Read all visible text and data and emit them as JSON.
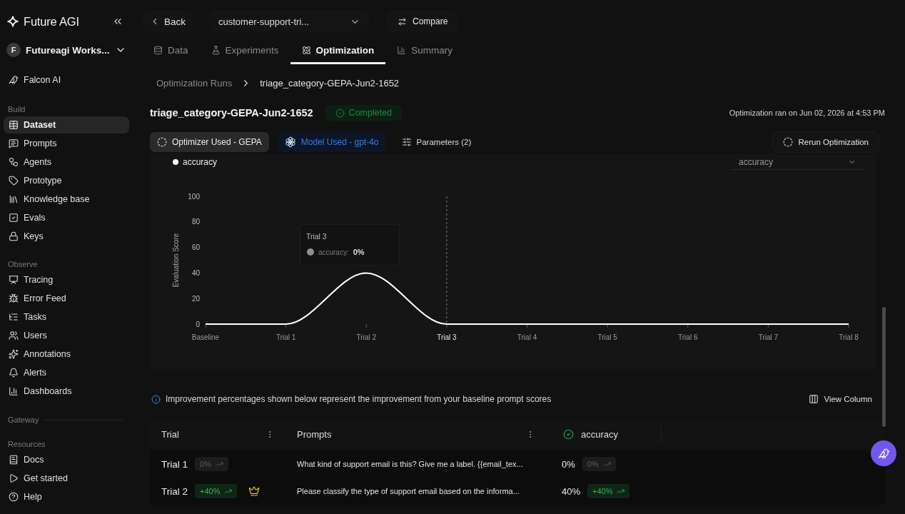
{
  "sidebar": {
    "brand": "Future AGI",
    "workspace": {
      "initial": "F",
      "name": "Futureagi Works..."
    },
    "pinned": [
      {
        "label": "Falcon AI",
        "selected": false
      }
    ],
    "sections": [
      {
        "title": "Build",
        "items": [
          {
            "label": "Dataset",
            "selected": true
          },
          {
            "label": "Prompts",
            "selected": false
          },
          {
            "label": "Agents",
            "selected": false
          },
          {
            "label": "Prototype",
            "selected": false
          },
          {
            "label": "Knowledge base",
            "selected": false
          },
          {
            "label": "Evals",
            "selected": false
          },
          {
            "label": "Keys",
            "selected": false
          }
        ]
      },
      {
        "title": "Observe",
        "items": [
          {
            "label": "Tracing",
            "selected": false
          },
          {
            "label": "Error Feed",
            "selected": false
          },
          {
            "label": "Tasks",
            "selected": false
          },
          {
            "label": "Users",
            "selected": false
          },
          {
            "label": "Annotations",
            "selected": false
          },
          {
            "label": "Alerts",
            "selected": false
          },
          {
            "label": "Dashboards",
            "selected": false
          }
        ]
      },
      {
        "title": "Gateway"
      },
      {
        "title": "Resources",
        "items": [
          {
            "label": "Docs",
            "selected": false
          },
          {
            "label": "Get started",
            "selected": false
          },
          {
            "label": "Help",
            "selected": false
          }
        ]
      }
    ]
  },
  "toolbar": {
    "back": "Back",
    "dataset": "customer-support-tri...",
    "compare": "Compare"
  },
  "tabs": [
    {
      "label": "Data",
      "selected": false
    },
    {
      "label": "Experiments",
      "selected": false
    },
    {
      "label": "Optimization",
      "selected": true
    },
    {
      "label": "Summary",
      "selected": false
    }
  ],
  "breadcrumb": [
    "Optimization Runs",
    "triage_category-GEPA-Jun2-1652"
  ],
  "run": {
    "title": "triage_category-GEPA-Jun2-1652",
    "status": {
      "label": "Completed",
      "kind": "success"
    },
    "ran_on": "Optimization ran on Jun 02, 2026 at 4:53 PM",
    "chips": [
      {
        "label": "Optimizer Used - GEPA",
        "kind": "optimizer"
      },
      {
        "label": "Model Used - gpt-4o",
        "kind": "model"
      },
      {
        "label": "Parameters (2)",
        "kind": "parameters"
      }
    ],
    "rerun": "Rerun Optimization"
  },
  "chart": {
    "metric_select": "accuracy",
    "chart_data": {
      "type": "line",
      "ylabel": "Evaluation Score",
      "categories": [
        "Baseline",
        "Trial 1",
        "Trial 2",
        "Trial 3",
        "Trial 4",
        "Trial 5",
        "Trial 6",
        "Trial 7",
        "Trial 8"
      ],
      "series": [
        {
          "name": "accuracy",
          "color": "#ffffff",
          "values": [
            0,
            0,
            40,
            0,
            0,
            0,
            0,
            0,
            0
          ]
        }
      ],
      "ylim": [
        0,
        100
      ],
      "yticks": [
        0,
        20,
        40,
        60,
        80,
        100
      ],
      "ref_lines": [
        {
          "axis": "x",
          "value": "Trial 3"
        }
      ]
    },
    "tooltip": {
      "title": "Trial 3",
      "label": "accuracy:",
      "value": "0%"
    }
  },
  "notice": "Improvement percentages shown below represent the improvement from your baseline prompt scores",
  "view_column": "View Column",
  "table": {
    "columns": [
      {
        "label": "Trial",
        "kind": "text"
      },
      {
        "label": "Prompts",
        "kind": "text"
      },
      {
        "label": "accuracy",
        "kind": "metric"
      }
    ],
    "rows": [
      {
        "trial": "Trial 1",
        "improvement": {
          "text": "0%",
          "kind": "neutral"
        },
        "best": false,
        "prompt": "What kind of support email is this? Give me a label. {{email_tex...",
        "score": "0%",
        "change": {
          "text": "0%",
          "kind": "neutral"
        }
      },
      {
        "trial": "Trial 2",
        "improvement": {
          "text": "+40%",
          "kind": "positive"
        },
        "best": true,
        "prompt": "Please classify the type of support email based on the informa...",
        "score": "40%",
        "change": {
          "text": "+40%",
          "kind": "positive"
        }
      }
    ]
  }
}
